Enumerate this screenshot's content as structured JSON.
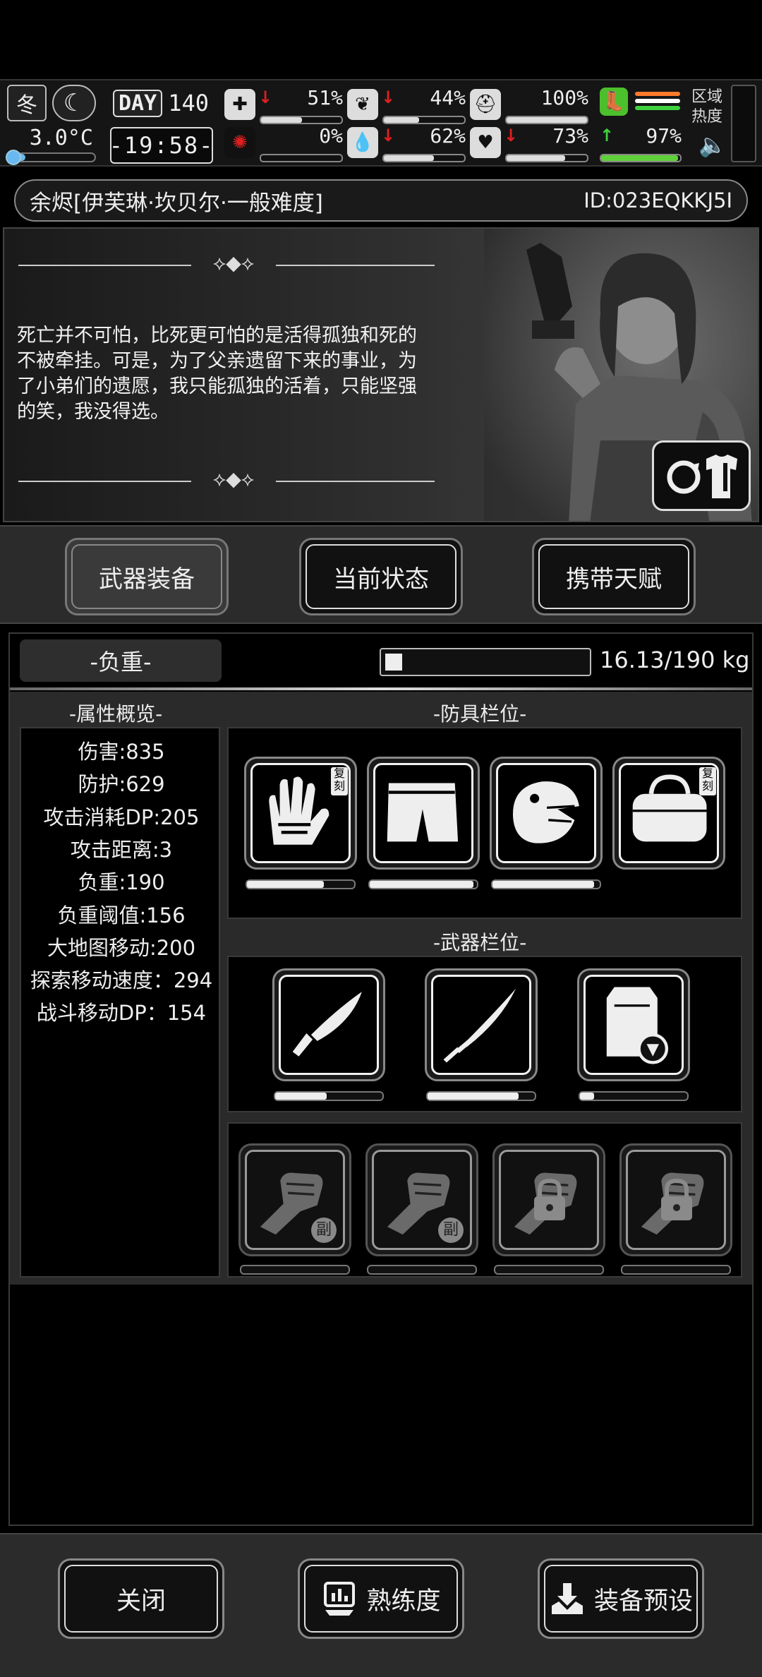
{
  "hud": {
    "season": "冬",
    "temperature": "3.0°C",
    "temperature_level": 0.2,
    "day_label": "DAY",
    "day_number": "140",
    "clock": "-19:58-",
    "stats": [
      {
        "key": "health",
        "icon": "medkit-icon",
        "arrow": "down",
        "value": "51%",
        "level": 0.51
      },
      {
        "key": "hunger",
        "icon": "stomach-icon",
        "arrow": "down",
        "value": "44%",
        "level": 0.44
      },
      {
        "key": "armor",
        "icon": "helmet-icon",
        "arrow": "",
        "value": "100%",
        "level": 1.0
      },
      {
        "key": "infection",
        "icon": "virus-icon",
        "arrow": "",
        "value": "0%",
        "level": 0.0
      },
      {
        "key": "thirst",
        "icon": "water-drop-icon",
        "arrow": "down",
        "value": "62%",
        "level": 0.62
      },
      {
        "key": "mood",
        "icon": "heart-icon",
        "arrow": "down",
        "value": "73%",
        "level": 0.73
      },
      {
        "key": "stamina",
        "icon": "boot-icon",
        "arrow": "up",
        "value": "97%",
        "level": 0.97
      }
    ],
    "region_label": "区域热度",
    "colors": {
      "arrow_down": "#e02020",
      "arrow_up": "#3fd23f",
      "stamina": "#5fd13a",
      "temp": "#6ab8f0",
      "heat_lines": [
        "#ff7a2a",
        "#ffffff",
        "#3fd23f"
      ]
    }
  },
  "character": {
    "name": "余烬",
    "title": "[伊芙琳·坎贝尔·一般难度]",
    "id": "ID:023EQKKJ5I",
    "quote": "死亡并不可怕，比死更可怕的是活得孤独和死的不被牵挂。可是，为了父亲遗留下来的事业，为了小弟们的遗愿，我只能孤独的活着，只能坚强的笑，我没得选。"
  },
  "tabs": [
    {
      "label": "武器装备",
      "active": true
    },
    {
      "label": "当前状态",
      "active": false
    },
    {
      "label": "携带天赋",
      "active": false
    }
  ],
  "load": {
    "label": "-负重-",
    "value": "16.13/190 kg",
    "fraction": 0.085
  },
  "attributes": {
    "title": "-属性概览-",
    "items": [
      "伤害:835",
      "防护:629",
      "攻击消耗DP:205",
      "攻击距离:3",
      "负重:190",
      "负重阈值:156",
      "大地图移动:200",
      "探索移动速度：294",
      "战斗移动DP：154"
    ]
  },
  "armor": {
    "title": "-防具栏位-",
    "slots": [
      {
        "icon": "gloves-icon",
        "badge": "复刻",
        "durability": 0.72
      },
      {
        "icon": "shorts-icon",
        "badge": "",
        "durability": 0.97
      },
      {
        "icon": "dino-mask-icon",
        "badge": "",
        "durability": 0.95
      },
      {
        "icon": "bag-icon",
        "badge": "复刻",
        "durability": 0
      }
    ]
  },
  "weapons": {
    "title": "-武器栏位-",
    "slots": [
      {
        "icon": "knife-icon",
        "durability": 0.48
      },
      {
        "icon": "katana-icon",
        "durability": 0.85
      },
      {
        "icon": "ammo-case-icon",
        "durability": 0.13
      }
    ]
  },
  "offhand": {
    "slots": [
      {
        "icon": "fist-icon",
        "mark": "副",
        "locked": false
      },
      {
        "icon": "fist-icon",
        "mark": "副",
        "locked": false
      },
      {
        "icon": "fist-icon",
        "mark": "",
        "locked": true
      },
      {
        "icon": "fist-icon",
        "mark": "",
        "locked": true
      }
    ]
  },
  "bottom": {
    "close": "关闭",
    "proficiency": "熟练度",
    "preset": "装备预设"
  }
}
